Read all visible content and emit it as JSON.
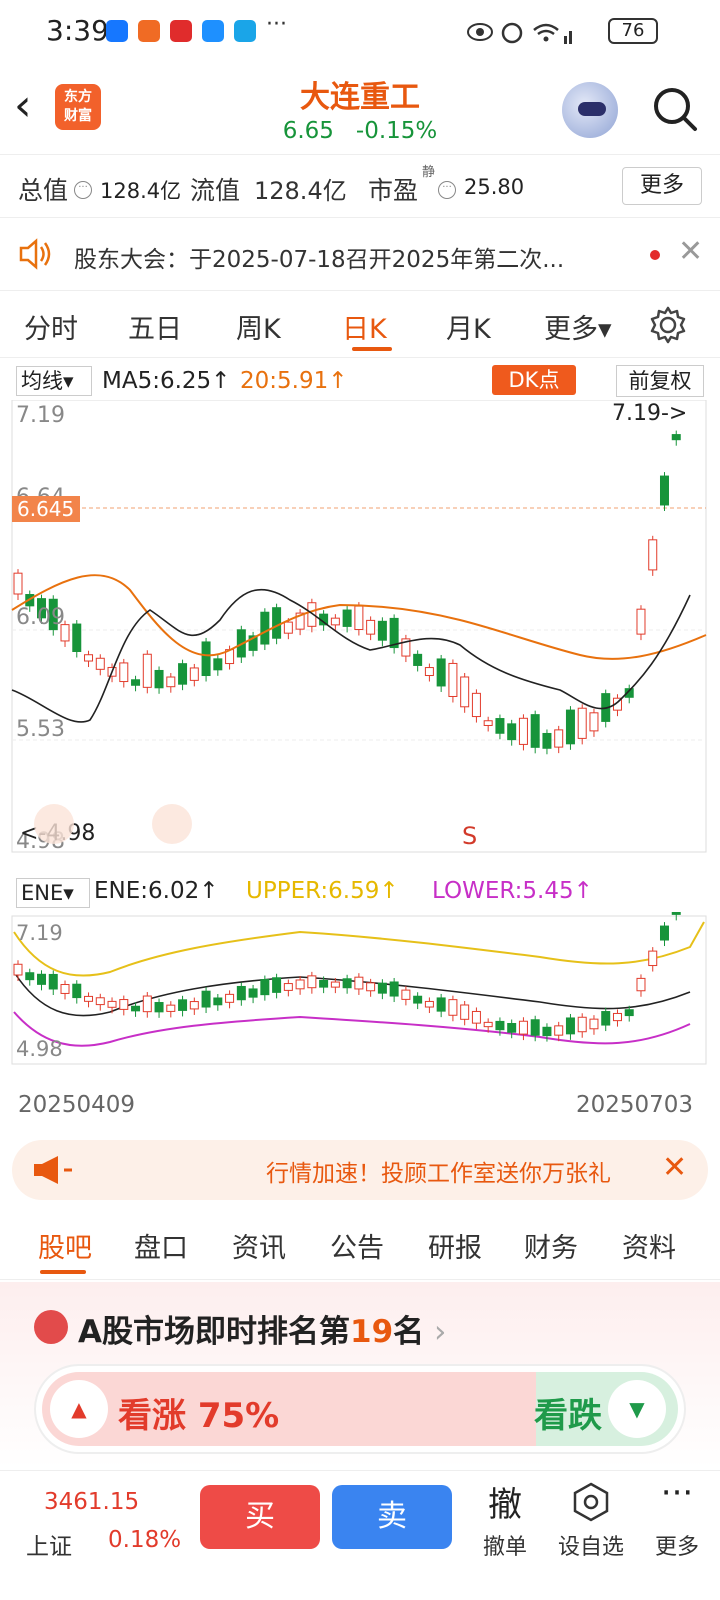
{
  "status": {
    "time": "3:39",
    "more": "···",
    "battery": "76"
  },
  "header": {
    "back": "‹",
    "logo_top": "东方",
    "logo_bottom": "财富",
    "name": "大连重工",
    "price": "6.65",
    "change": "-0.15%"
  },
  "metrics": {
    "total_label": "总值",
    "total_value": "128.4亿",
    "float_label": "流值",
    "float_value": "128.4亿",
    "pe_label": "市盈",
    "pe_sup": "静",
    "pe_value": "25.80",
    "more": "更多"
  },
  "notice": {
    "text": "股东大会：于2025-07-18召开2025年第二次..."
  },
  "tabs": [
    "分时",
    "五日",
    "周K",
    "日K",
    "月K",
    "更多▾"
  ],
  "ma": {
    "select": "均线▾",
    "ma5": "MA5:6.25↑",
    "ma20": "20:5.91↑",
    "dk": "DK点",
    "adjust": "前复权"
  },
  "kchart": {
    "y_labels": [
      "7.19",
      "6.64",
      "6.645",
      "6.09",
      "5.53",
      "4.98"
    ],
    "high_marker": "7.19->",
    "low_marker": "<-4.98",
    "signal_s": "S"
  },
  "ene": {
    "select": "ENE▾",
    "ene": "ENE:6.02↑",
    "upper": "UPPER:6.59↑",
    "lower": "LOWER:5.45↑",
    "y_top": "7.19",
    "y_bottom": "4.98",
    "date_start": "20250409",
    "date_end": "20250703"
  },
  "promo": {
    "text": "行情加速！投顾工作室送你万张礼"
  },
  "subtabs": [
    "股吧",
    "盘口",
    "资讯",
    "公告",
    "研报",
    "财务",
    "资料"
  ],
  "rank": {
    "prefix": "A股市场即时排名第",
    "num": "19",
    "suffix": "名"
  },
  "vote": {
    "up": "看涨 75%",
    "down": "看跌"
  },
  "bottom": {
    "index_value": "3461.15",
    "index_name": "上证",
    "index_pct": "0.18%",
    "buy": "买",
    "sell": "卖",
    "cancel_icon": "撤",
    "cancel": "撤单",
    "watch": "设自选",
    "more": "更多"
  },
  "colors": {
    "up": "#e23b2b",
    "down": "#17943a",
    "accent": "#e8580f"
  }
}
